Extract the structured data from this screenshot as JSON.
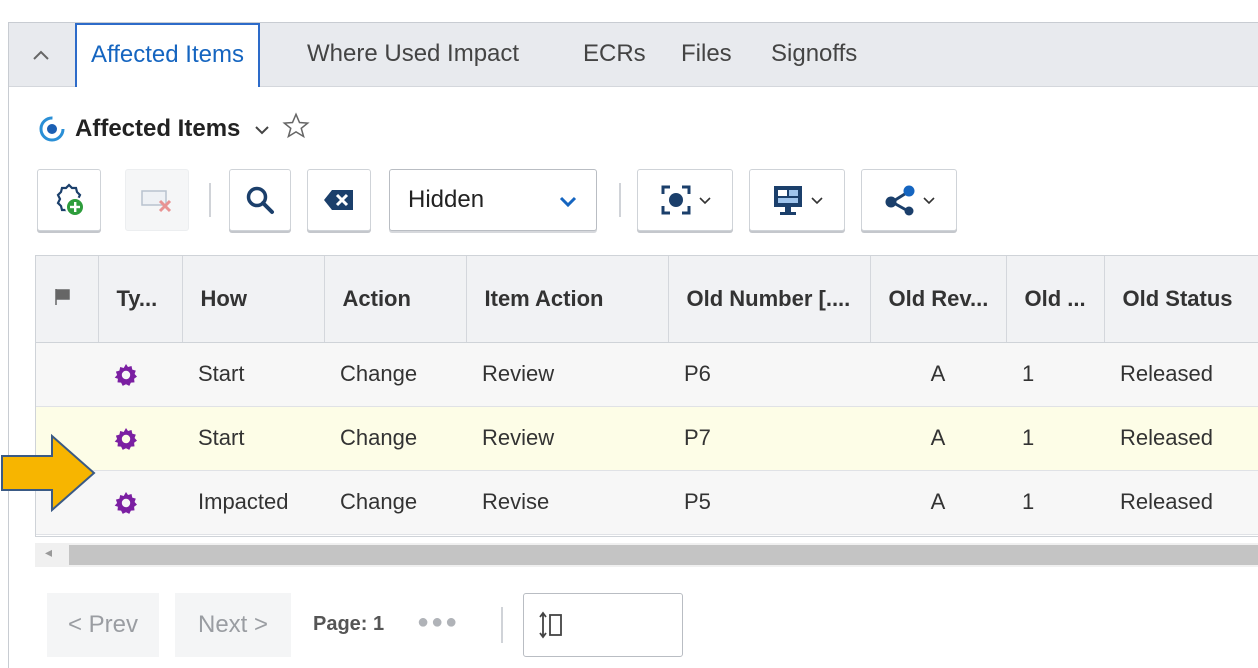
{
  "tabs": [
    {
      "label": "Affected Items",
      "active": true
    },
    {
      "label": "Where Used Impact"
    },
    {
      "label": "ECRs"
    },
    {
      "label": "Files"
    },
    {
      "label": "Signoffs"
    }
  ],
  "panel": {
    "title": "Affected Items"
  },
  "toolbar": {
    "select_value": "Hidden",
    "icons": [
      "add-gear-icon",
      "remove-item-icon",
      "search-icon",
      "clear-icon",
      "view-mode-icon",
      "display-icon",
      "share-icon"
    ]
  },
  "grid": {
    "columns": [
      "",
      "Ty...",
      "How",
      "Action",
      "Item Action",
      "Old Number [....",
      "Old Rev...",
      "Old ...",
      "Old Status"
    ],
    "rows": [
      {
        "how": "Start",
        "action": "Change",
        "item_action": "Review",
        "old_number": "P6",
        "old_rev": "A",
        "old_gen": "1",
        "old_status": "Released"
      },
      {
        "how": "Start",
        "action": "Change",
        "item_action": "Review",
        "old_number": "P7",
        "old_rev": "A",
        "old_gen": "1",
        "old_status": "Released"
      },
      {
        "how": "Impacted",
        "action": "Change",
        "item_action": "Revise",
        "old_number": "P5",
        "old_rev": "A",
        "old_gen": "1",
        "old_status": "Released"
      }
    ]
  },
  "pager": {
    "prev_label": "< Prev",
    "next_label": "Next >",
    "page_label": "Page: 1",
    "more": "●●●"
  },
  "colors": {
    "accent": "#1565c0",
    "gear": "#7b1fa2",
    "highlight_row": "#fdfde7",
    "arrow": "#f7b500"
  }
}
